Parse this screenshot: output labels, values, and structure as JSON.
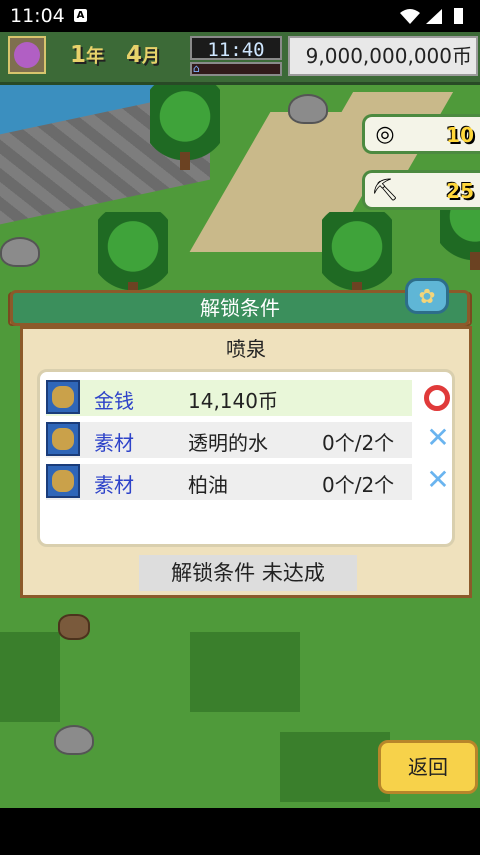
{
  "status_bar": {
    "time": "11:04",
    "icon_a": "A"
  },
  "header": {
    "year": "1",
    "year_unit": "年",
    "month": "4",
    "month_unit": "月",
    "clock": "11:40",
    "money": "9,000,000,000币"
  },
  "resources": [
    {
      "icon": "medal-icon",
      "value": "10"
    },
    {
      "icon": "pickaxe-icon",
      "value": "25"
    }
  ],
  "dialog": {
    "title": "解锁条件",
    "item_name": "喷泉",
    "requirements": [
      {
        "category": "金钱",
        "name": "14,140币",
        "qty": "",
        "met": true,
        "icon": "gold-coins-icon"
      },
      {
        "category": "素材",
        "name": "透明的水",
        "qty": "0个/2个",
        "met": false,
        "icon": "bag-icon"
      },
      {
        "category": "素材",
        "name": "柏油",
        "qty": "0个/2个",
        "met": false,
        "icon": "bag-icon"
      }
    ],
    "status": "解锁条件 未达成"
  },
  "back_button": "返回"
}
